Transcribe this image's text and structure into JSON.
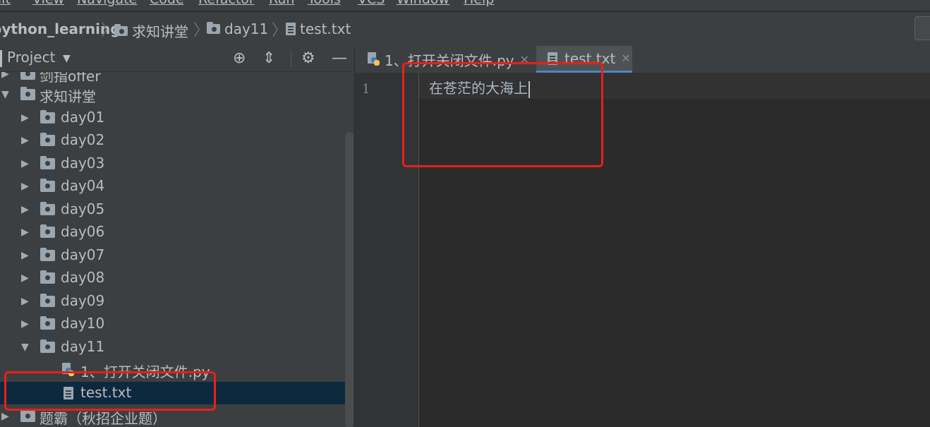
{
  "menu": [
    "Edit",
    "View",
    "Navigate",
    "Code",
    "Refactor",
    "Run",
    "Tools",
    "VCS",
    "Window",
    "Help"
  ],
  "breadcrumb": {
    "root": "python_learning",
    "items": [
      "求知讲堂",
      "day11",
      "test.txt"
    ]
  },
  "project_panel": {
    "title": "Project",
    "icons": [
      "crosshair-icon",
      "collapse-icon",
      "gear-icon",
      "minimize-icon"
    ]
  },
  "tree": {
    "partial_top": "剑指offer",
    "group": "求知讲堂",
    "days": [
      "day01",
      "day02",
      "day03",
      "day04",
      "day05",
      "day06",
      "day07",
      "day08",
      "day09",
      "day10"
    ],
    "open_day": "day11",
    "files": [
      "1、打开关闭文件.py",
      "test.txt"
    ],
    "partial_bottom": "题霸（秋招企业题）"
  },
  "editor": {
    "tabs": [
      {
        "label": "1、打开关闭文件.py",
        "icon": "python-file-icon",
        "active": false
      },
      {
        "label": "test.txt",
        "icon": "text-file-icon",
        "active": true
      }
    ],
    "line_number": "1",
    "content": "在苍茫的大海上"
  },
  "colors": {
    "accent": "#4a88c7",
    "annotation": "#e8201a",
    "selection": "#0d293e"
  }
}
